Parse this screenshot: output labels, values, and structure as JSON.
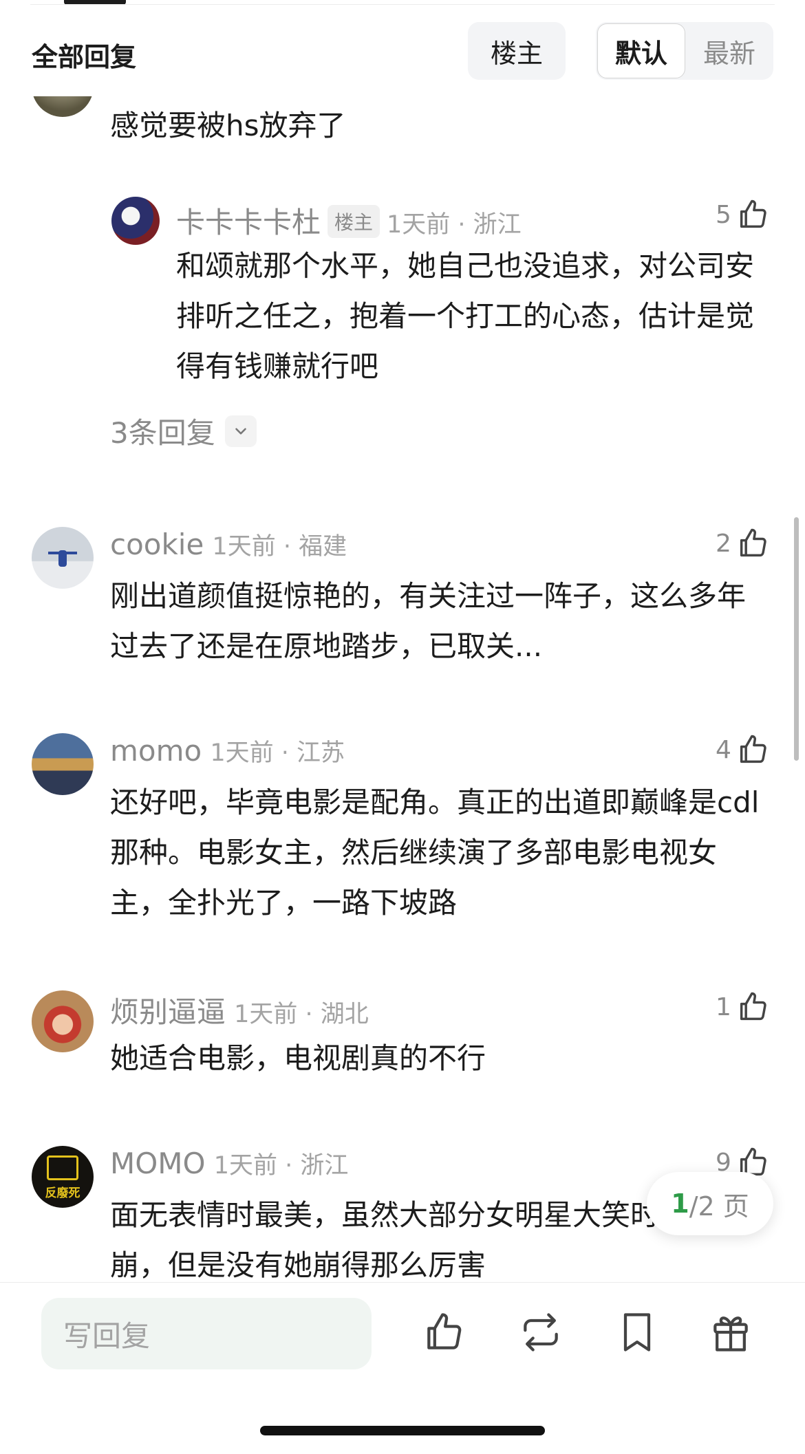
{
  "header": {
    "title": "全部回复",
    "filter_louzhu": "楼主",
    "sort_default": "默认",
    "sort_latest": "最新"
  },
  "top_comment": {
    "text": "感觉要被hs放弃了"
  },
  "sub_reply": {
    "name": "卡卡卡卡杜",
    "tag": "楼主",
    "meta": "1天前 · 浙江",
    "likes": "5",
    "text": "和颂就那个水平，她自己也没追求，对公司安排听之任之，抱着一个打工的心态，估计是觉得有钱赚就行吧",
    "more_replies": "3条回复"
  },
  "comments": [
    {
      "name": "cookie",
      "meta": "1天前 · 福建",
      "likes": "2",
      "text": "刚出道颜值挺惊艳的，有关注过一阵子，这么多年过去了还是在原地踏步，已取关..."
    },
    {
      "name": "momo",
      "meta": "1天前 · 江苏",
      "likes": "4",
      "text": "还好吧，毕竟电影是配角。真正的出道即巅峰是cdl那种。电影女主，然后继续演了多部电影电视女主，全扑光了，一路下坡路"
    },
    {
      "name": "烦别逼逼",
      "meta": "1天前 · 湖北",
      "likes": "1",
      "text": "她适合电影，电视剧真的不行"
    },
    {
      "name": "MOMO",
      "meta": "1天前 · 浙江",
      "likes": "9",
      "text": "面无表情时最美，虽然大部分女明星大笑时也会崩，但是没有她崩得那么厉害",
      "avatar_text": "反廢死"
    }
  ],
  "pager": {
    "current": "1",
    "total": "/2 页"
  },
  "bottom_bar": {
    "reply_placeholder": "写回复"
  },
  "icons": [
    "thumb-up-icon",
    "chevron-down-icon",
    "repost-icon",
    "bookmark-icon",
    "gift-icon"
  ],
  "colors": {
    "accent_green": "#2e9b48",
    "muted_text": "#8a8a8a",
    "input_bg": "#f0f5f2"
  }
}
